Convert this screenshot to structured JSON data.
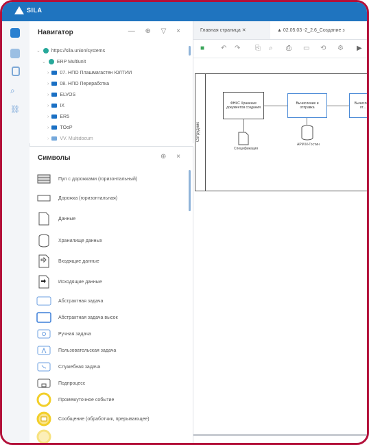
{
  "app": {
    "logo_text": "SILA",
    "accent": "#1f74bf",
    "frame_color": "#b3103a"
  },
  "navigator": {
    "title": "Навигатор",
    "tools": "— ⊕ ▽ ×",
    "items": [
      {
        "label": "https://sila.union/systems",
        "icon": "globe-icon"
      },
      {
        "label": "ERP Multiunit",
        "icon": "globe-icon"
      },
      {
        "label": "07. НПО Плашмагастен ЮЛТИИ",
        "icon": "folder-icon"
      },
      {
        "label": "08. НПО Переработка",
        "icon": "folder-icon"
      },
      {
        "label": "ELVOS",
        "icon": "folder-icon"
      },
      {
        "label": "IX",
        "icon": "folder-icon"
      },
      {
        "label": "ER5",
        "icon": "folder-icon"
      },
      {
        "label": "TOoP",
        "icon": "folder-icon"
      },
      {
        "label": "VV. Multidocum",
        "icon": "folder-icon"
      }
    ]
  },
  "symbols": {
    "title": "Символы",
    "tools": "⊕ ×",
    "items": [
      {
        "label": "Пул с дорожками (горизонтальный)",
        "icon": "pool-lanes-icon"
      },
      {
        "label": "Дорожка (горизонтальная)",
        "icon": "lane-icon"
      },
      {
        "label": "Данные",
        "icon": "data-object-icon"
      },
      {
        "label": "Хранилище данных",
        "icon": "data-store-icon"
      },
      {
        "label": "Входящие данные",
        "icon": "data-input-icon"
      },
      {
        "label": "Исходящие данные",
        "icon": "data-output-icon"
      },
      {
        "label": "Абстрактная задача",
        "icon": "abstract-task-icon"
      },
      {
        "label": "Абстрактная задача высок",
        "icon": "abstract-task-tall-icon"
      },
      {
        "label": "Ручная задача",
        "icon": "manual-task-icon"
      },
      {
        "label": "Пользовательская задача",
        "icon": "user-task-icon"
      },
      {
        "label": "Служебная задача",
        "icon": "service-task-icon"
      },
      {
        "label": "Подпроцесс",
        "icon": "subprocess-icon"
      },
      {
        "label": "Промежуточное событие",
        "icon": "intermediate-event-icon"
      },
      {
        "label": "Сообщение (обработчик, прерывающее)",
        "icon": "message-event-icon"
      }
    ]
  },
  "tabs": [
    {
      "label": "Главная страница ✕"
    },
    {
      "label": "▲ 02.05.03 -2_2.6_Создание з"
    }
  ],
  "diagram": {
    "pool_label": "Сотрудник",
    "task1": "ФНКС Хранение документов создания",
    "task2": "Вычисление и отправка",
    "task3": "Вычисле... от...",
    "doc_label": "Спецификация",
    "store_label": "АРМ И-Гостин"
  }
}
